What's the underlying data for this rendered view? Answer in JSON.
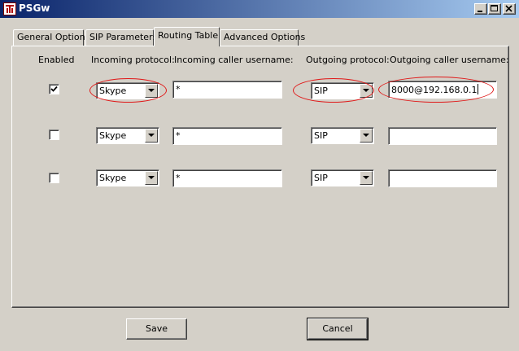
{
  "window": {
    "title": "PSGw"
  },
  "tabs": [
    {
      "label": "General Options",
      "active": false
    },
    {
      "label": "SIP Parameters",
      "active": false
    },
    {
      "label": "Routing Table",
      "active": true
    },
    {
      "label": "Advanced Options",
      "active": false
    }
  ],
  "columns": {
    "enabled": "Enabled",
    "incoming_protocol": "Incoming protocol:",
    "incoming_username": "Incoming caller username:",
    "outgoing_protocol": "Outgoing protocol:",
    "outgoing_username": "Outgoing caller username:"
  },
  "routes": [
    {
      "enabled": true,
      "incoming_protocol": "Skype",
      "incoming_username": "*",
      "outgoing_protocol": "SIP",
      "outgoing_username": "8000@192.168.0.1"
    },
    {
      "enabled": false,
      "incoming_protocol": "Skype",
      "incoming_username": "*",
      "outgoing_protocol": "SIP",
      "outgoing_username": ""
    },
    {
      "enabled": false,
      "incoming_protocol": "Skype",
      "incoming_username": "*",
      "outgoing_protocol": "SIP",
      "outgoing_username": ""
    }
  ],
  "buttons": {
    "save": "Save",
    "cancel": "Cancel"
  },
  "colors": {
    "titlebar_start": "#0a246a",
    "titlebar_end": "#a6caf0",
    "face": "#d4d0c8",
    "annotation": "#e01818"
  }
}
